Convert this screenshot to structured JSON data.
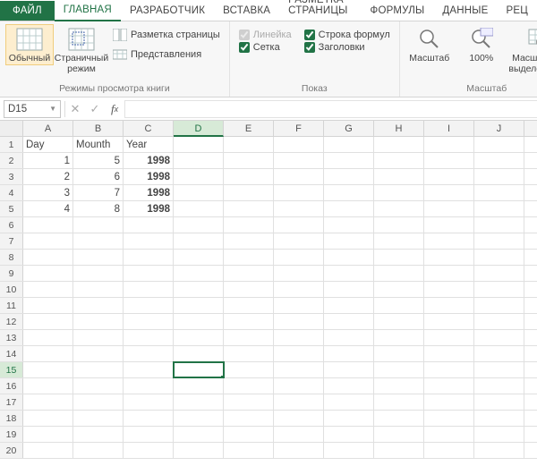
{
  "tabs": {
    "file": "ФАЙЛ",
    "home": "ГЛАВНАЯ",
    "dev": "Разработчик",
    "insert": "ВСТАВКА",
    "layout": "РАЗМЕТКА СТРАНИЦЫ",
    "formulas": "ФОРМУЛЫ",
    "data": "ДАННЫЕ",
    "rev": "РЕЦ"
  },
  "view": {
    "normal": "Обычный",
    "pagebreak": "Страничный режим",
    "page_layout": "Разметка страницы",
    "custom_views": "Представления",
    "group_views": "Режимы просмотра книги",
    "ruler": "Линейка",
    "formula_bar": "Строка формул",
    "gridlines": "Сетка",
    "headings": "Заголовки",
    "group_show": "Показ",
    "zoom": "Масштаб",
    "zoom100": "100%",
    "zoom_sel": "Масштаб по выделенному",
    "group_zoom": "Масштаб"
  },
  "namebox": "D15",
  "columns": [
    "A",
    "B",
    "C",
    "D",
    "E",
    "F",
    "G",
    "H",
    "I",
    "J"
  ],
  "headers": {
    "A": "Day",
    "B": "Mounth",
    "C": "Year"
  },
  "data_rows": [
    {
      "A": "1",
      "B": "5",
      "C": "1998"
    },
    {
      "A": "2",
      "B": "6",
      "C": "1998"
    },
    {
      "A": "3",
      "B": "7",
      "C": "1998"
    },
    {
      "A": "4",
      "B": "8",
      "C": "1998"
    }
  ],
  "selected": {
    "col": "D",
    "row": 15
  }
}
